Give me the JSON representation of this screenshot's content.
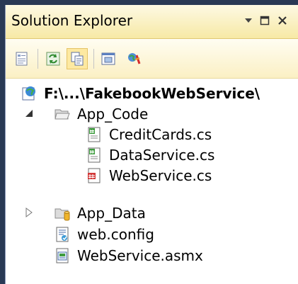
{
  "window": {
    "title": "Solution Explorer"
  },
  "title_buttons": [
    {
      "name": "dropdown-arrow-icon"
    },
    {
      "name": "maximize-icon"
    },
    {
      "name": "close-icon"
    }
  ],
  "toolbar": {
    "buttons": [
      {
        "name": "properties-icon"
      },
      {
        "name": "refresh-icon"
      },
      {
        "name": "show-all-files-icon",
        "active": true
      },
      {
        "name": "view-designer-icon"
      },
      {
        "name": "copy-website-icon"
      }
    ]
  },
  "tree": {
    "root": {
      "label": "F:\\...\\FakebookWebService\\",
      "icon": "website-project-icon"
    },
    "items": [
      {
        "label": "App_Code",
        "icon": "open-folder-icon",
        "expanded": true
      },
      {
        "label": "CreditCards.cs",
        "icon": "csharp-file-icon"
      },
      {
        "label": "DataService.cs",
        "icon": "csharp-file-icon"
      },
      {
        "label": "WebService.cs",
        "icon": "csharp-file-icon"
      },
      {
        "label": "App_Data",
        "icon": "data-folder-icon",
        "expanded": false
      },
      {
        "label": "web.config",
        "icon": "config-file-icon"
      },
      {
        "label": "WebService.asmx",
        "icon": "asmx-file-icon"
      }
    ]
  },
  "colors": {
    "frame": "#293955",
    "titlebar": "#f7e9a5",
    "toolbar": "#fbf0c4",
    "active_button": "#fde9a1"
  }
}
